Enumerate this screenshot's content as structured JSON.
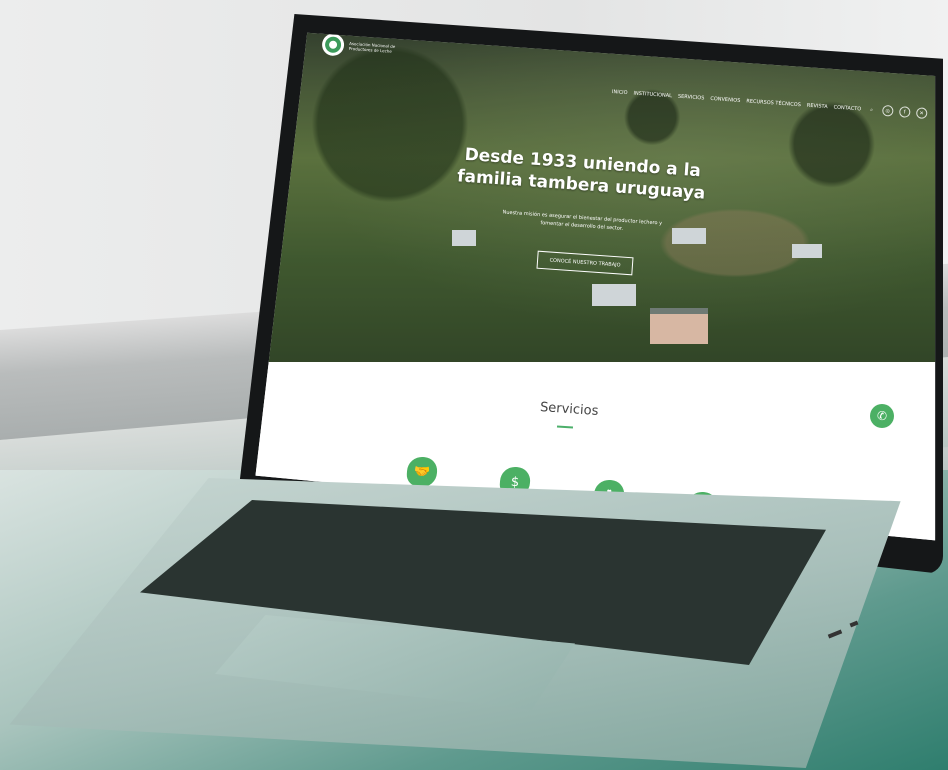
{
  "site": {
    "logo_text": "Asociación Nacional de Productores de Leche"
  },
  "nav": {
    "items": [
      "INICIO",
      "INSTITUCIONAL",
      "SERVICIOS",
      "CONVENIOS",
      "RECURSOS TÉCNICOS",
      "REVISTA",
      "CONTACTO"
    ],
    "icons": [
      "search-icon",
      "instagram-icon",
      "facebook-icon",
      "x-icon"
    ]
  },
  "hero": {
    "title": "Desde 1933 uniendo a la familia tambera uruguaya",
    "description": "Nuestra misión es asegurar el bienestar del productor lechero y fomentar el desarrollo del sector.",
    "cta_label": "CONOCÉ NUESTRO TRABAJO"
  },
  "services": {
    "title": "Servicios",
    "icons": [
      "handshake-icon",
      "money-icon",
      "person-leaf-icon",
      "scale-icon"
    ]
  },
  "whatsapp": {
    "icon": "whatsapp-icon"
  },
  "colors": {
    "brand_green": "#4cb064",
    "dark": "#151718"
  }
}
